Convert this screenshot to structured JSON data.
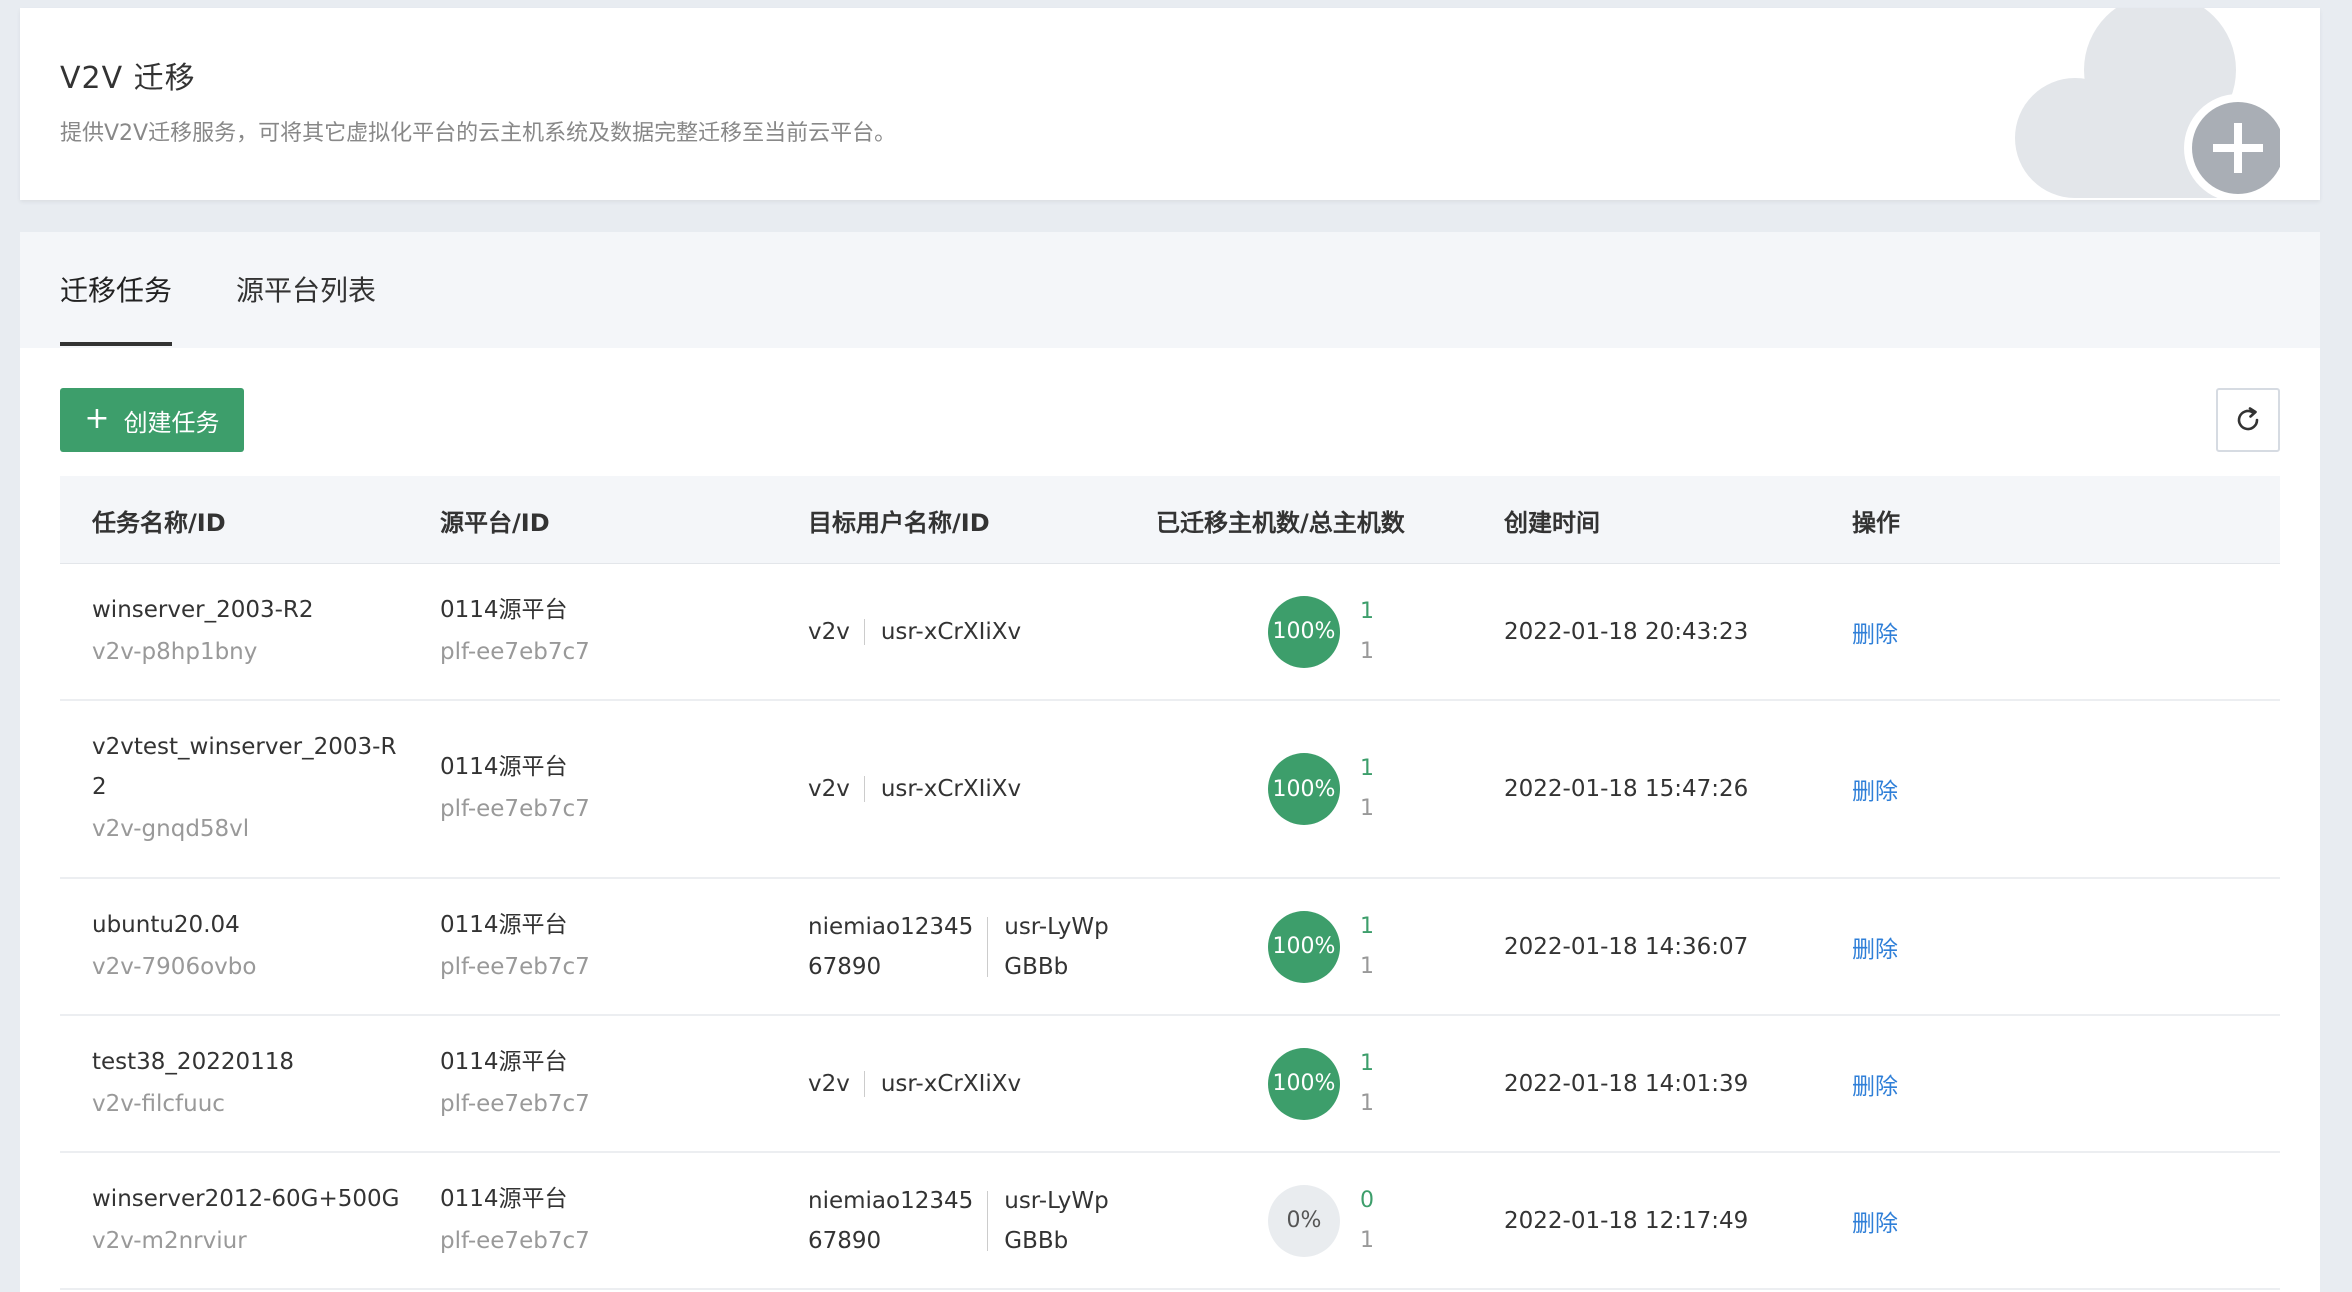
{
  "header": {
    "title": "V2V 迁移",
    "description": "提供V2V迁移服务，可将其它虚拟化平台的云主机系统及数据完整迁移至当前云平台。"
  },
  "tabs": [
    {
      "label": "迁移任务",
      "active": true
    },
    {
      "label": "源平台列表",
      "active": false
    }
  ],
  "toolbar": {
    "create_label": "创建任务"
  },
  "colors": {
    "accent": "#3d9e6b",
    "link": "#2f7fd8"
  },
  "table": {
    "columns": [
      "任务名称/ID",
      "源平台/ID",
      "目标用户名称/ID",
      "已迁移主机数/总主机数",
      "创建时间",
      "操作"
    ],
    "rows": [
      {
        "name": "winserver_2003-R2",
        "id": "v2v-p8hp1bny",
        "platform": "0114源平台",
        "platform_id": "plf-ee7eb7c7",
        "user_name": "v2v",
        "user_id": "usr-xCrXIiXv",
        "progress": "100%",
        "migrated": "1",
        "total": "1",
        "created": "2022-01-18 20:43:23",
        "action": "删除"
      },
      {
        "name": "v2vtest_winserver_2003-R\n2",
        "id": "v2v-gnqd58vl",
        "platform": "0114源平台",
        "platform_id": "plf-ee7eb7c7",
        "user_name": "v2v",
        "user_id": "usr-xCrXIiXv",
        "progress": "100%",
        "migrated": "1",
        "total": "1",
        "created": "2022-01-18 15:47:26",
        "action": "删除"
      },
      {
        "name": "ubuntu20.04",
        "id": "v2v-7906ovbo",
        "platform": "0114源平台",
        "platform_id": "plf-ee7eb7c7",
        "user_name": "niemiao12345\n67890",
        "user_id": "usr-LyWp\nGBBb",
        "progress": "100%",
        "migrated": "1",
        "total": "1",
        "created": "2022-01-18 14:36:07",
        "action": "删除"
      },
      {
        "name": "test38_20220118",
        "id": "v2v-filcfuuc",
        "platform": "0114源平台",
        "platform_id": "plf-ee7eb7c7",
        "user_name": "v2v",
        "user_id": "usr-xCrXIiXv",
        "progress": "100%",
        "migrated": "1",
        "total": "1",
        "created": "2022-01-18 14:01:39",
        "action": "删除"
      },
      {
        "name": "winserver2012-60G+500G",
        "id": "v2v-m2nrviur",
        "platform": "0114源平台",
        "platform_id": "plf-ee7eb7c7",
        "user_name": "niemiao12345\n67890",
        "user_id": "usr-LyWp\nGBBb",
        "progress": "0%",
        "migrated": "0",
        "total": "1",
        "created": "2022-01-18 12:17:49",
        "action": "删除"
      }
    ]
  }
}
